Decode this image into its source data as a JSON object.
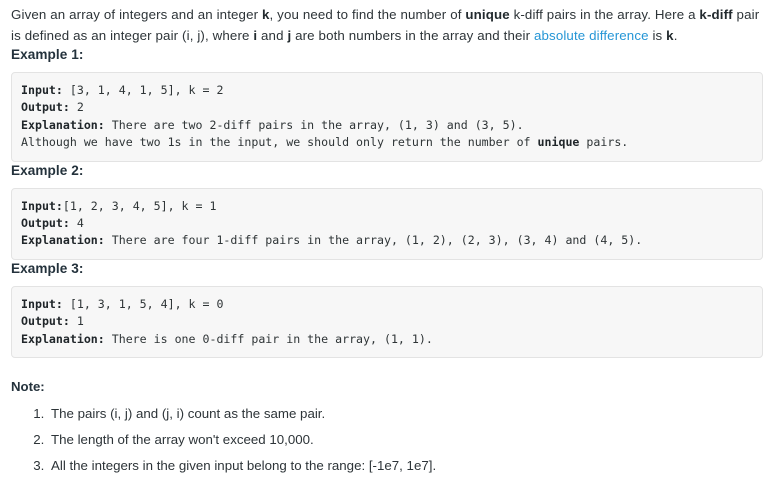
{
  "intro": {
    "seg1": "Given an array of integers and an integer ",
    "k1": "k",
    "seg2": ", you need to find the number of ",
    "unique": "unique",
    "seg3": " k-diff pairs in the array. Here a ",
    "kdiff": "k-diff",
    "seg4": " pair is defined as an integer pair (i, j), where ",
    "i": "i",
    "seg5": " and ",
    "j": "j",
    "seg6": " are both numbers in the array and their ",
    "link": "absolute difference",
    "seg7": " is ",
    "k2": "k",
    "seg8": "."
  },
  "examples": [
    {
      "heading": "Example 1:",
      "lines": [
        {
          "label": "Input:",
          "rest": " [3, 1, 4, 1, 5], k = 2"
        },
        {
          "label": "Output:",
          "rest": " 2"
        },
        {
          "label": "Explanation:",
          "rest": " There are two 2-diff pairs in the array, (1, 3) and (3, 5)."
        },
        {
          "label": "",
          "rest": "Although we have two 1s in the input, we should only return the number of "
        },
        {
          "label": "",
          "rest": "",
          "inline_bold": "unique",
          "tail": " pairs."
        }
      ]
    },
    {
      "heading": "Example 2:",
      "lines": [
        {
          "label": "Input:",
          "rest": "[1, 2, 3, 4, 5], k = 1"
        },
        {
          "label": "Output:",
          "rest": " 4"
        },
        {
          "label": "Explanation:",
          "rest": " There are four 1-diff pairs in the array, (1, 2), (2, 3), (3, 4) and (4, 5)."
        }
      ]
    },
    {
      "heading": "Example 3:",
      "lines": [
        {
          "label": "Input:",
          "rest": " [1, 3, 1, 5, 4], k = 0"
        },
        {
          "label": "Output:",
          "rest": " 1"
        },
        {
          "label": "Explanation:",
          "rest": " There is one 0-diff pair in the array, (1, 1)."
        }
      ]
    }
  ],
  "code_text": {
    "ex1_l1_label": "Input:",
    "ex1_l1_rest": " [3, 1, 4, 1, 5], k = 2",
    "ex1_l2_label": "Output:",
    "ex1_l2_rest": " 2",
    "ex1_l3_label": "Explanation:",
    "ex1_l3_rest": " There are two 2-diff pairs in the array, (1, 3) and (3, 5).",
    "ex1_l4_pre": "Although we have two 1s in the input, we should only return the number of ",
    "ex1_l4_bold": "unique",
    "ex1_l4_post": " pairs.",
    "ex2_l1_label": "Input:",
    "ex2_l1_rest": "[1, 2, 3, 4, 5], k = 1",
    "ex2_l2_label": "Output:",
    "ex2_l2_rest": " 4",
    "ex2_l3_label": "Explanation:",
    "ex2_l3_rest": " There are four 1-diff pairs in the array, (1, 2), (2, 3), (3, 4) and (4, 5).",
    "ex3_l1_label": "Input:",
    "ex3_l1_rest": " [1, 3, 1, 5, 4], k = 0",
    "ex3_l2_label": "Output:",
    "ex3_l2_rest": " 1",
    "ex3_l3_label": "Explanation:",
    "ex3_l3_rest": " There is one 0-diff pair in the array, (1, 1)."
  },
  "headings": {
    "example1": "Example 1:",
    "example2": "Example 2:",
    "example3": "Example 3:",
    "note": "Note:"
  },
  "notes": [
    "The pairs (i, j) and (j, i) count as the same pair.",
    "The length of the array won't exceed 10,000.",
    "All the integers in the given input belong to the range: [-1e7, 1e7]."
  ],
  "colors": {
    "text": "#2d3438",
    "heading": "#24323c",
    "link": "#2596d6",
    "code_bg": "#f7f7f7",
    "code_border": "#e3e3e3",
    "page_bg": "#ffffff"
  }
}
